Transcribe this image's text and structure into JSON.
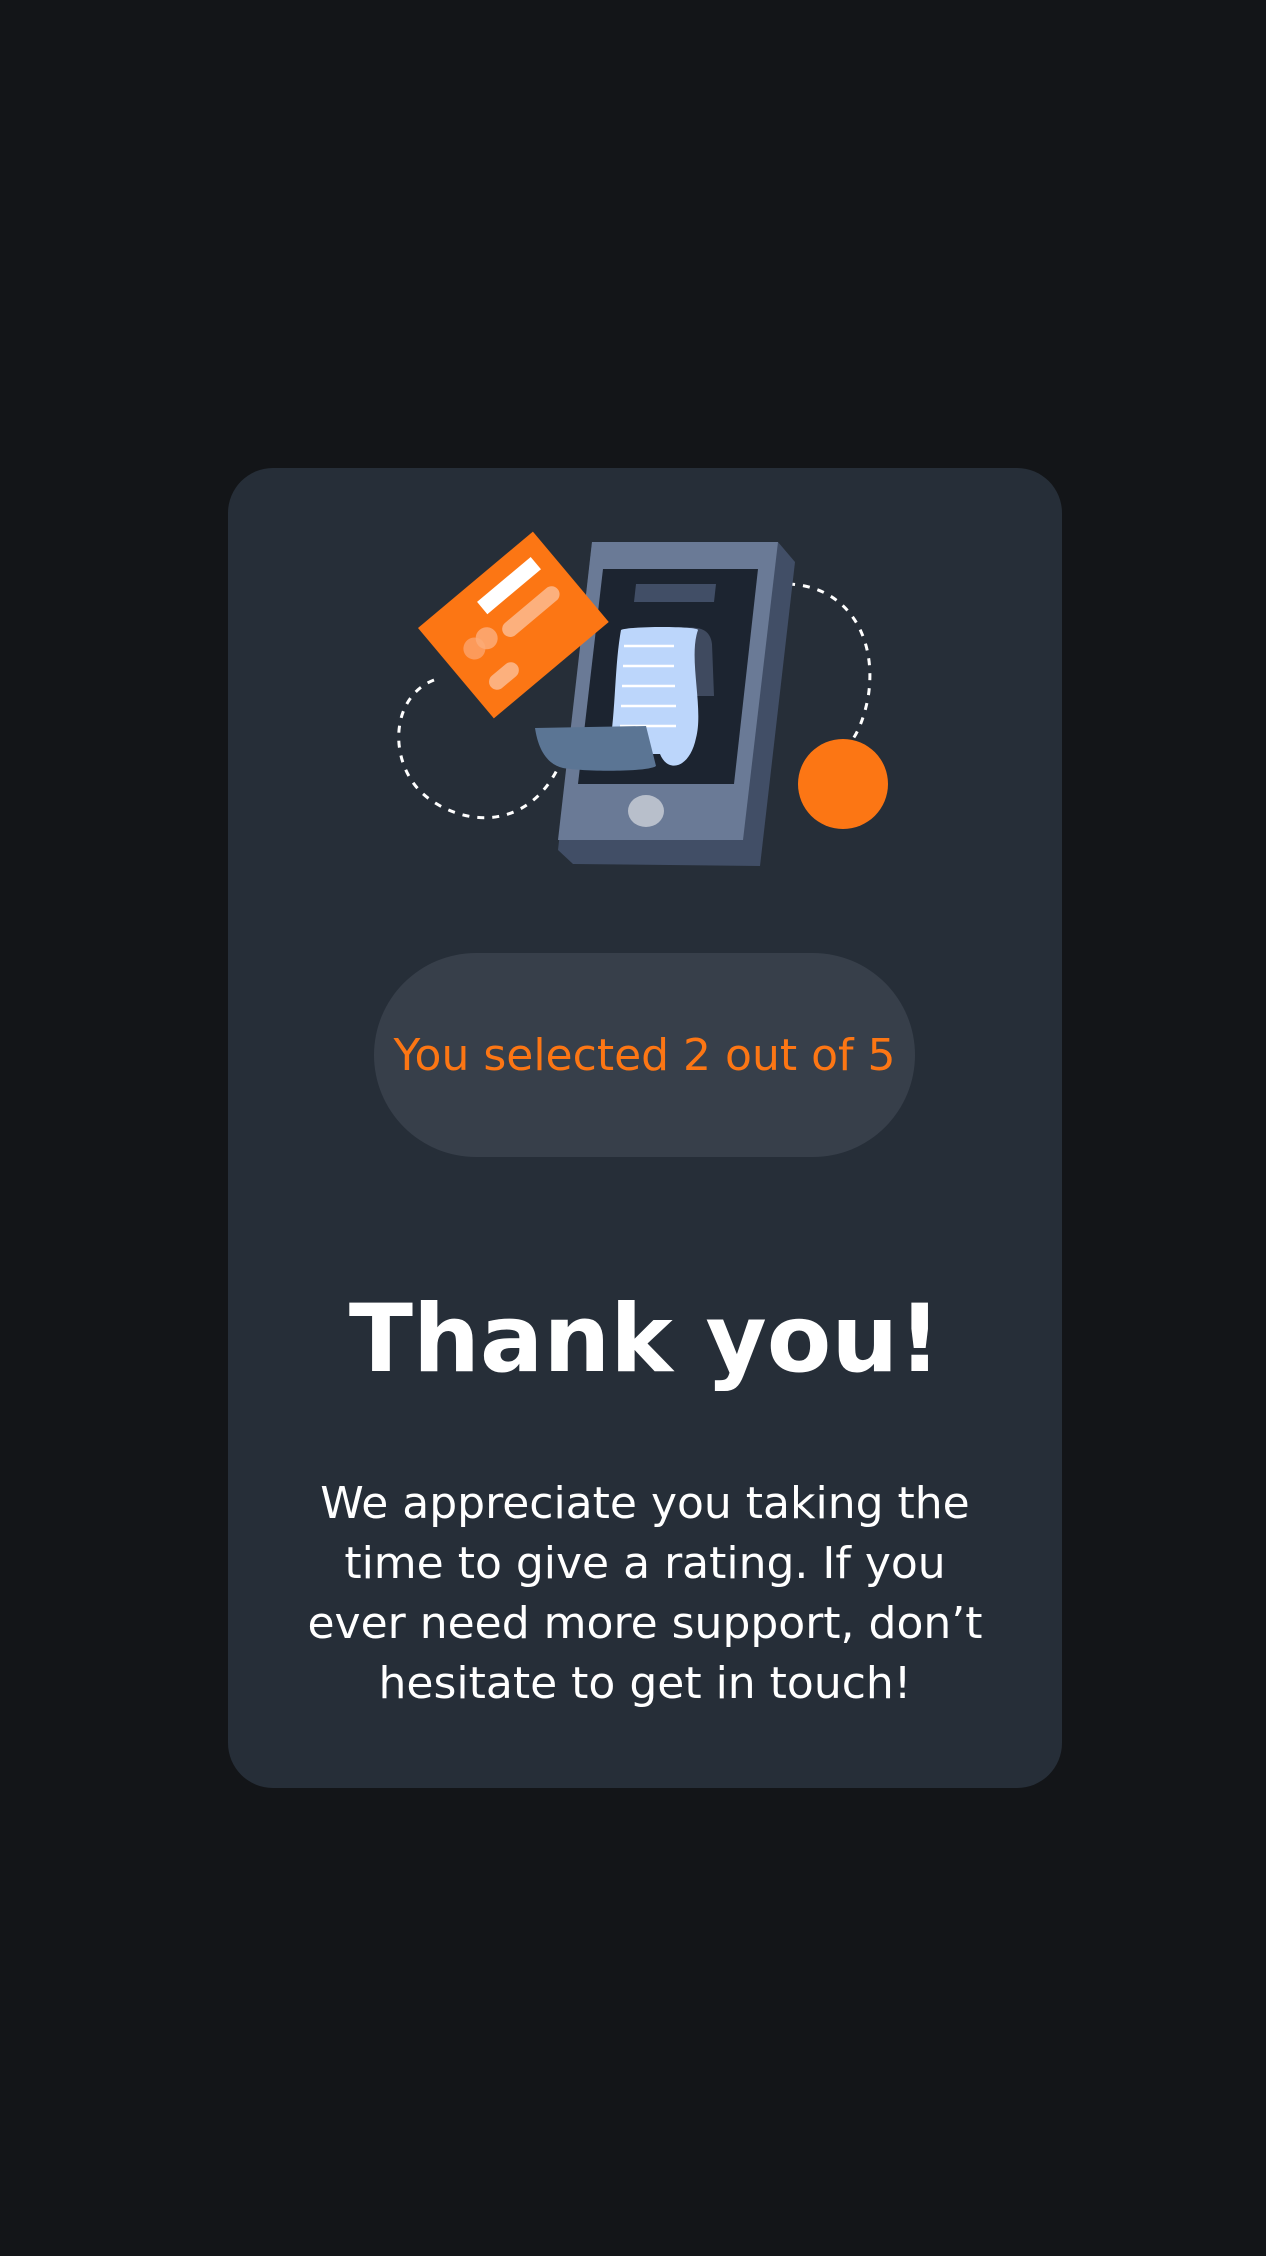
{
  "card": {
    "badge_text": "You selected 2 out of 5",
    "title": "Thank you!",
    "message": "We appreciate you taking the time to give a rating. If you ever need more support, don’t hesitate to get in touch!"
  },
  "illustration": {
    "icon": "payment-phone-illustration",
    "accent_color": "#fc7614"
  },
  "colors": {
    "background": "#131518",
    "card": "#262e38",
    "badge": "#373f4a",
    "accent": "#fc7614",
    "text": "#ffffff"
  }
}
